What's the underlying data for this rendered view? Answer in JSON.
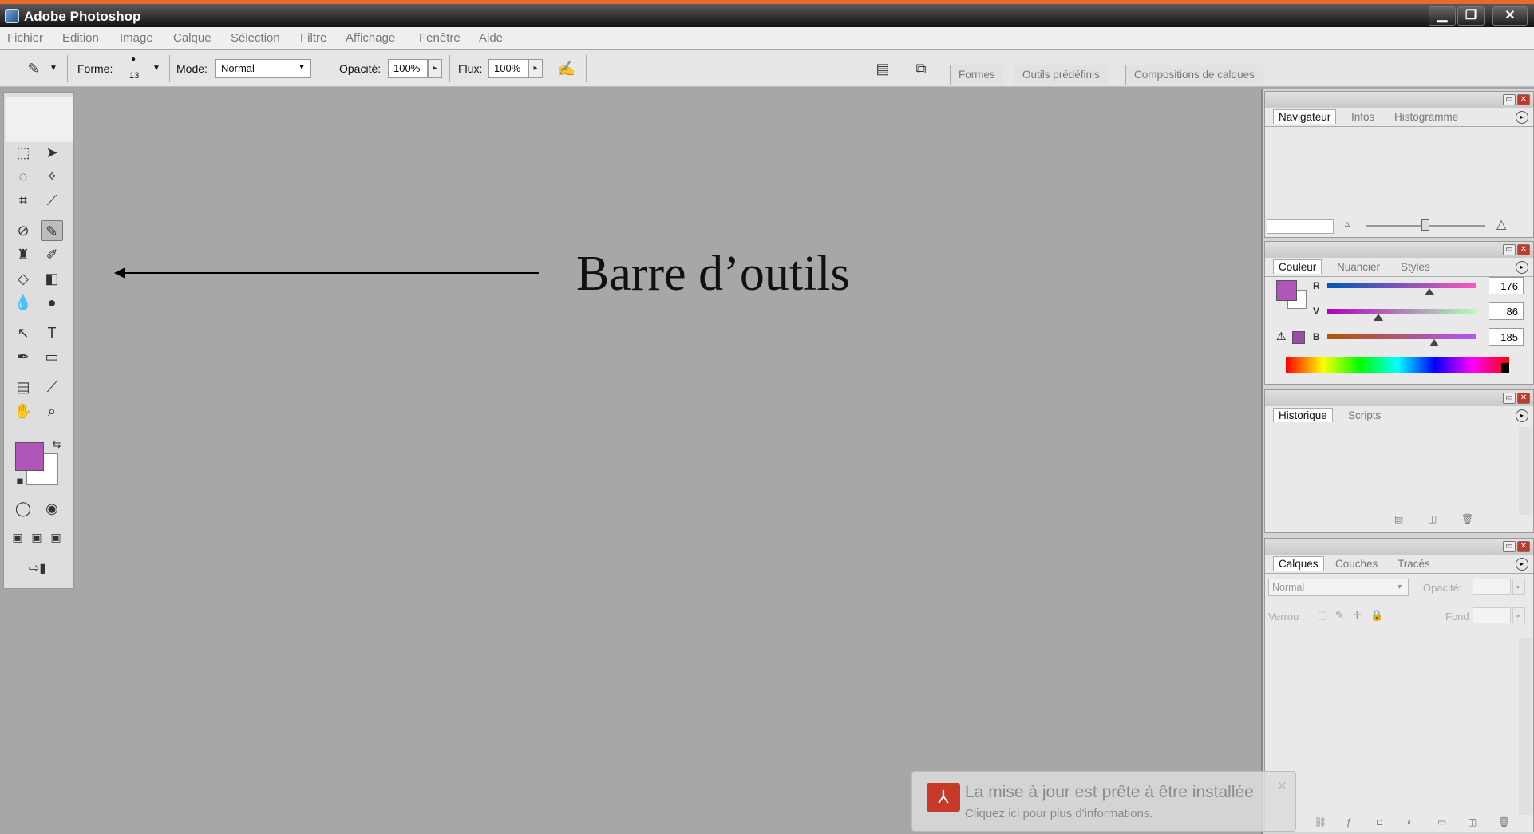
{
  "window": {
    "title": "Adobe Photoshop"
  },
  "menu": [
    "Fichier",
    "Edition",
    "Image",
    "Calque",
    "Sélection",
    "Filtre",
    "Affichage",
    "Fenêtre",
    "Aide"
  ],
  "options": {
    "forme_label": "Forme:",
    "brush_size": "13",
    "mode_label": "Mode:",
    "mode_value": "Normal",
    "opacity_label": "Opacité:",
    "opacity_value": "100%",
    "flux_label": "Flux:",
    "flux_value": "100%"
  },
  "palette_well": [
    "Formes",
    "Outils prédéfinis",
    "Compositions de calques"
  ],
  "annotation": {
    "label": "Barre d’outils"
  },
  "colors": {
    "foreground": "#b056b9",
    "background": "#ffffff",
    "accent": "#e8692a"
  },
  "navigator_panel": {
    "tabs": [
      "Navigateur",
      "Infos",
      "Histogramme"
    ]
  },
  "color_panel": {
    "tabs": [
      "Couleur",
      "Nuancier",
      "Styles"
    ],
    "channels": [
      {
        "label": "R",
        "value": "176"
      },
      {
        "label": "V",
        "value": "86"
      },
      {
        "label": "B",
        "value": "185"
      }
    ]
  },
  "history_panel": {
    "tabs": [
      "Historique",
      "Scripts"
    ]
  },
  "layers_panel": {
    "tabs": [
      "Calques",
      "Couches",
      "Tracés"
    ],
    "blend_mode": "Normal",
    "opacity_label": "Opacité:",
    "lock_label": "Verrou :",
    "fill_label": "Fond :"
  },
  "notification": {
    "title": "La mise à jour est prête à être installée",
    "body": "Cliquez ici pour plus d'informations."
  }
}
